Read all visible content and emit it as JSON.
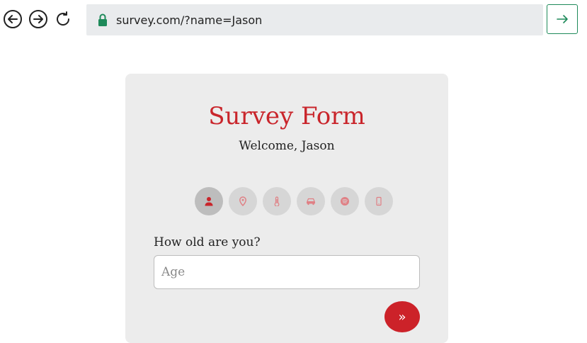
{
  "browser": {
    "url": "survey.com/?name=Jason",
    "accent": "#1e8a5a"
  },
  "form": {
    "title": "Survey Form",
    "welcome": "Welcome, Jason",
    "steps": [
      {
        "icon": "person-icon",
        "active": true
      },
      {
        "icon": "location-pin-icon",
        "active": false
      },
      {
        "icon": "thermometer-icon",
        "active": false
      },
      {
        "icon": "car-icon",
        "active": false
      },
      {
        "icon": "spotify-icon",
        "active": false
      },
      {
        "icon": "mobile-phone-icon",
        "active": false
      }
    ],
    "question": "How old are you?",
    "age_placeholder": "Age",
    "age_value": "",
    "next_label": "»",
    "accent": "#cc2229"
  }
}
